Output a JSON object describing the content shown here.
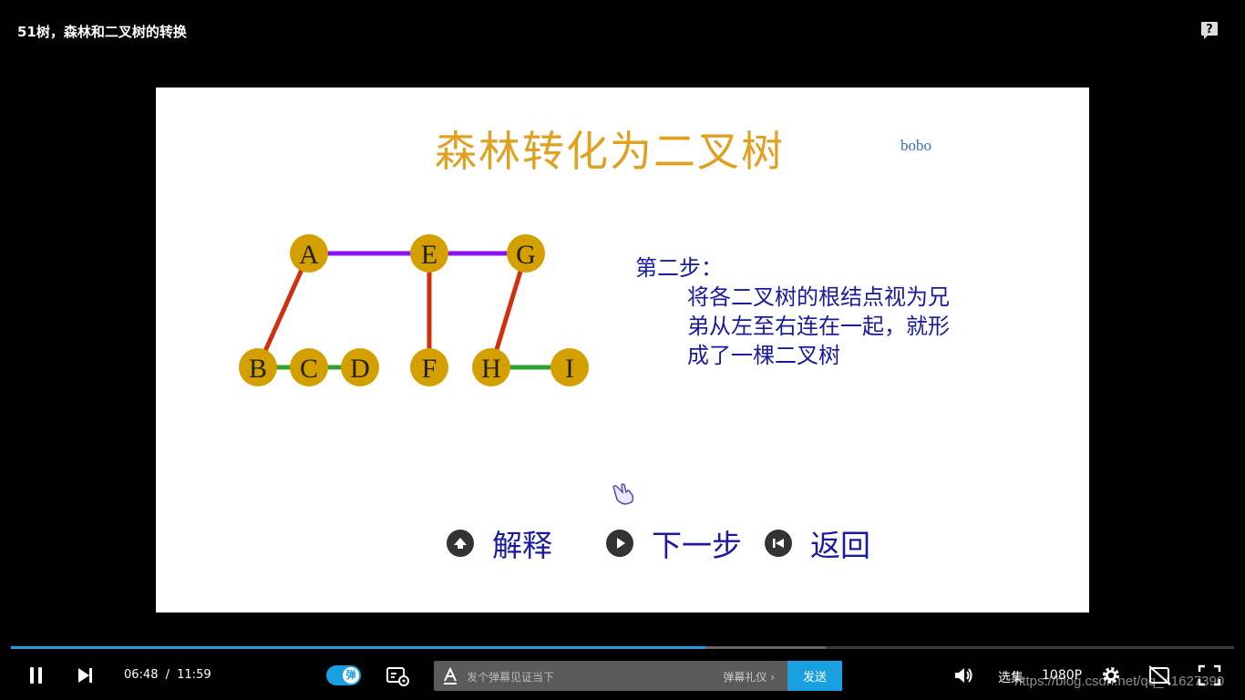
{
  "video": {
    "title": "51树，森林和二叉树的转换"
  },
  "slide": {
    "title": "森林转化为二叉树",
    "author": "bobo",
    "graph": {
      "nodes": [
        {
          "id": "A",
          "label": "A"
        },
        {
          "id": "E",
          "label": "E"
        },
        {
          "id": "G",
          "label": "G"
        },
        {
          "id": "B",
          "label": "B"
        },
        {
          "id": "C",
          "label": "C"
        },
        {
          "id": "D",
          "label": "D"
        },
        {
          "id": "F",
          "label": "F"
        },
        {
          "id": "H",
          "label": "H"
        },
        {
          "id": "I",
          "label": "I"
        }
      ],
      "edges": [
        {
          "from": "A",
          "to": "E",
          "color": "#8b10f0"
        },
        {
          "from": "E",
          "to": "G",
          "color": "#8b10f0"
        },
        {
          "from": "A",
          "to": "B",
          "color": "#d03010"
        },
        {
          "from": "E",
          "to": "F",
          "color": "#d03010"
        },
        {
          "from": "G",
          "to": "H",
          "color": "#d03010"
        },
        {
          "from": "B",
          "to": "C",
          "color": "#30a030"
        },
        {
          "from": "C",
          "to": "D",
          "color": "#30a030"
        },
        {
          "from": "H",
          "to": "I",
          "color": "#30a030"
        }
      ],
      "node_color": "#d4a000"
    },
    "step": {
      "title": "第二步：",
      "body": "将各二叉树的根结点视为兄弟从左至右连在一起，就形成了一棵二叉树"
    },
    "buttons": {
      "explain": "解释",
      "next": "下一步",
      "back": "返回"
    }
  },
  "player": {
    "current_time": "06:48",
    "separator": "/",
    "duration": "11:59",
    "played_fraction": 0.568,
    "buffered_fraction": 0.666,
    "danmaku_toggle_label": "弹",
    "danmaku_placeholder": "发个弹幕见证当下",
    "danmaku_gift": "弹幕礼仪",
    "send_label": "发送",
    "episodes_label": "选集",
    "quality_label": "1080P",
    "watermark": "https://blog.csdn.net/qq_41627390",
    "accent_color": "#1aa0e0"
  }
}
